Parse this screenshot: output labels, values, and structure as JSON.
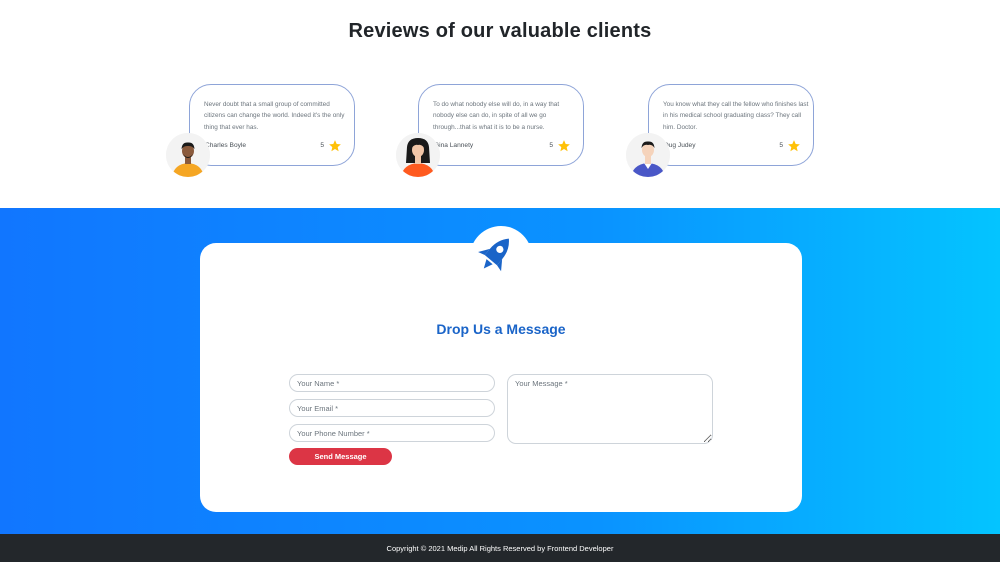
{
  "reviews": {
    "title": "Reviews of our valuable clients",
    "items": [
      {
        "text": "Never doubt that a small group of committed citizens can change the world. Indeed it's the only thing that ever has.",
        "name": "Charles Boyle",
        "rating": "5",
        "shirt_color": "#f5a623"
      },
      {
        "text": "To do what nobody else will do, in a way that nobody else can do, in spite of all we go through...that is what it is to be a nurse.",
        "name": "Gina Lannety",
        "rating": "5",
        "shirt_color": "#ff5a1f"
      },
      {
        "text": "You know what they call the fellow who finishes last in his medical school graduating class? They call him. Doctor.",
        "name": "Dug Judey",
        "rating": "5",
        "shirt_color": "#4a57c7"
      }
    ]
  },
  "contact": {
    "title": "Drop Us a Message",
    "name_placeholder": "Your Name *",
    "email_placeholder": "Your Email *",
    "phone_placeholder": "Your Phone Number *",
    "message_placeholder": "Your Message *",
    "send_label": "Send Message",
    "icon": "rocket-icon"
  },
  "footer": {
    "copyright": "Copyright © 2021 Medip All Rights Reserved by Frontend Developer"
  },
  "colors": {
    "accent": "#1a64c8",
    "button": "#dc3545",
    "star": "#ffc107",
    "footer_bg": "#23272b"
  }
}
